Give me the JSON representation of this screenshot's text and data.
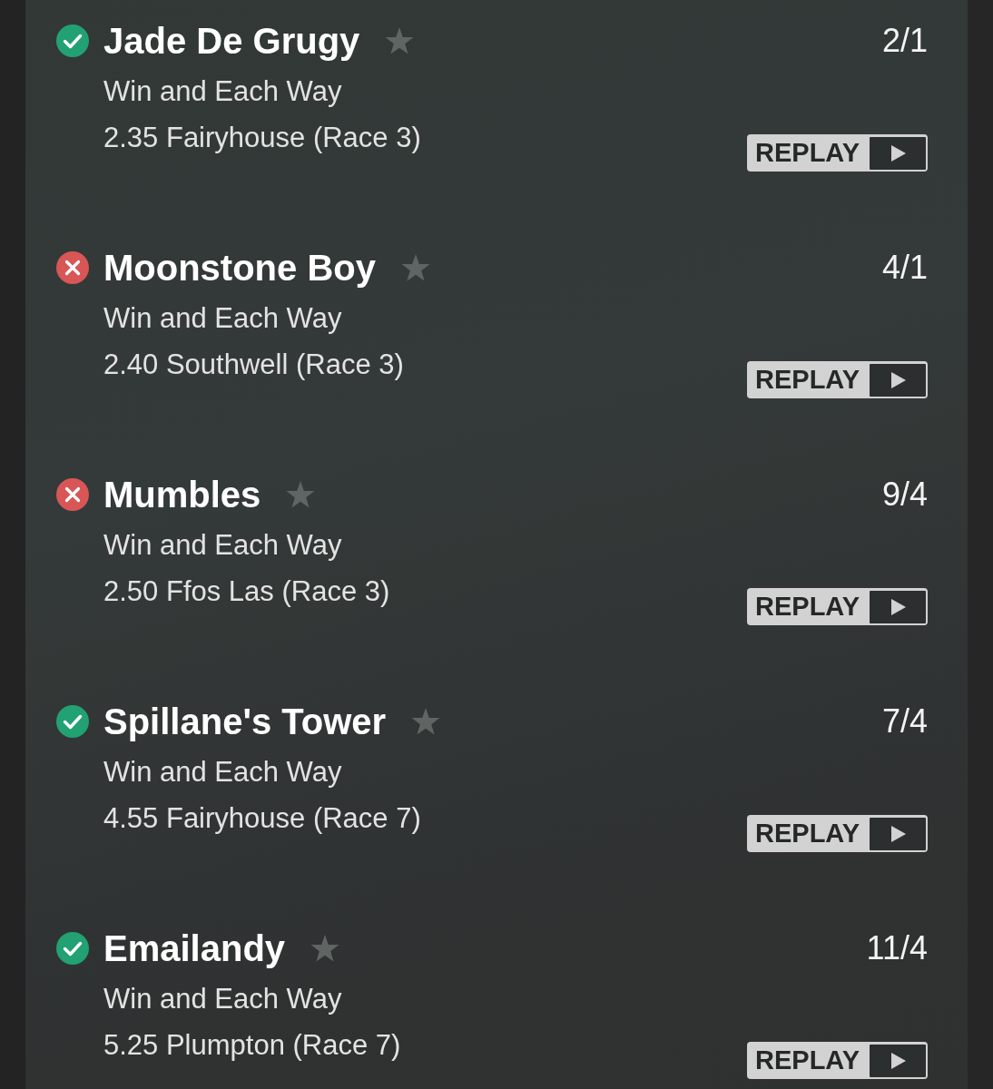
{
  "bets": [
    {
      "won": true,
      "name": "Jade De Grugy",
      "starred": false,
      "bet_type": "Win and Each Way",
      "race": "2.35 Fairyhouse (Race 3)",
      "odds": "2/1",
      "replay_label": "REPLAY"
    },
    {
      "won": false,
      "name": "Moonstone Boy",
      "starred": false,
      "bet_type": "Win and Each Way",
      "race": "2.40 Southwell (Race 3)",
      "odds": "4/1",
      "replay_label": "REPLAY"
    },
    {
      "won": false,
      "name": "Mumbles",
      "starred": false,
      "bet_type": "Win and Each Way",
      "race": "2.50 Ffos Las (Race 3)",
      "odds": "9/4",
      "replay_label": "REPLAY"
    },
    {
      "won": true,
      "name": "Spillane's Tower",
      "starred": false,
      "bet_type": "Win and Each Way",
      "race": "4.55 Fairyhouse (Race 7)",
      "odds": "7/4",
      "replay_label": "REPLAY"
    },
    {
      "won": true,
      "name": "Emailandy",
      "starred": false,
      "bet_type": "Win and Each Way",
      "race": "5.25 Plumpton (Race 7)",
      "odds": "11/4",
      "replay_label": "REPLAY"
    }
  ]
}
